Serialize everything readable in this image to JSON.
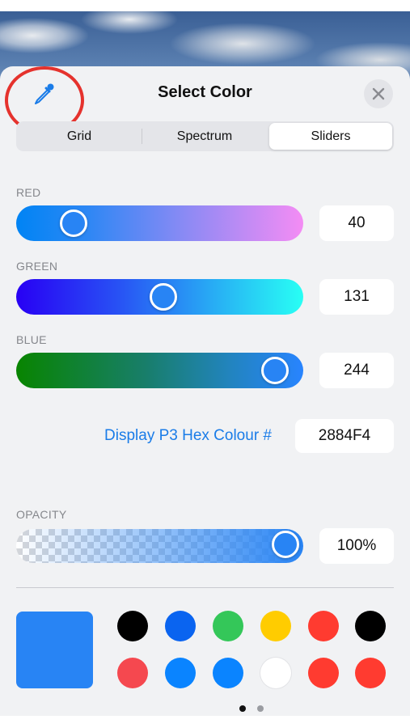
{
  "header": {
    "title": "Select Color",
    "eyedropper_icon": "eyedropper-icon",
    "close_icon": "close-icon"
  },
  "tabs": [
    {
      "label": "Grid",
      "selected": false
    },
    {
      "label": "Spectrum",
      "selected": false
    },
    {
      "label": "Sliders",
      "selected": true
    }
  ],
  "sliders": {
    "red": {
      "label": "RED",
      "value": "40",
      "max": 255
    },
    "green": {
      "label": "GREEN",
      "value": "131",
      "max": 255
    },
    "blue": {
      "label": "BLUE",
      "value": "244",
      "max": 255
    }
  },
  "hex": {
    "label": "Display P3 Hex Colour #",
    "value": "2884F4"
  },
  "opacity": {
    "label": "OPACITY",
    "value": "100%",
    "fraction": 1.0
  },
  "colors": {
    "selected": "#2884F4",
    "accent": "#1a7ce8",
    "annotation_ring": "#e5322d",
    "swatches": [
      "#000000",
      "#0a64f0",
      "#34c759",
      "#ffcc00",
      "#ff3b30",
      "#000000",
      "#f5484f",
      "#0a84ff",
      "#0a84ff",
      "#ffffff",
      "#ff3b30",
      "#ff3b30"
    ]
  },
  "pagination": {
    "pages": 2,
    "current": 1
  }
}
